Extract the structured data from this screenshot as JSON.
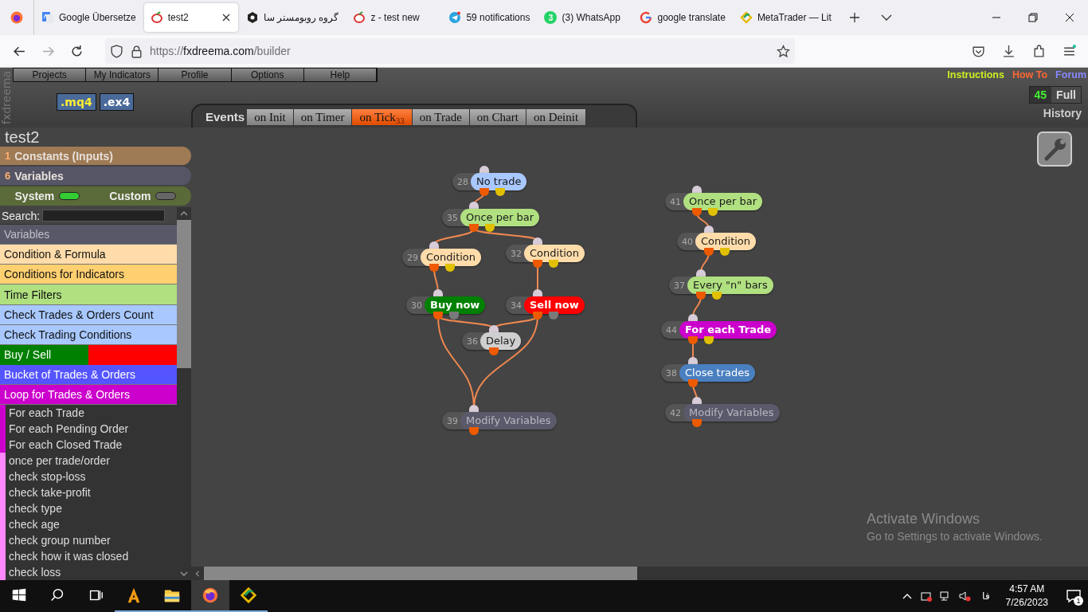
{
  "browser": {
    "tabs": [
      {
        "kind": "translate",
        "title": "Google Übersetze",
        "selected": false
      },
      {
        "kind": "fxdreema",
        "title": "test2",
        "selected": true
      },
      {
        "kind": "hexagon",
        "title": "گروه روبومستر سا",
        "selected": false
      },
      {
        "kind": "fxdreema",
        "title": "z - test new",
        "selected": false
      },
      {
        "kind": "telegram",
        "title": "59 notifications",
        "selected": false
      },
      {
        "kind": "whatsapp",
        "title": "(3) WhatsApp",
        "badge": "3",
        "selected": false
      },
      {
        "kind": "google",
        "title": "google translate",
        "selected": false
      },
      {
        "kind": "metatrader",
        "title": "MetaTrader — Lit",
        "selected": false
      }
    ],
    "url": {
      "scheme": "https://",
      "host": "fxdreema.com",
      "path": "/builder"
    }
  },
  "app": {
    "logo": "fxdreema",
    "menu": [
      "Projects",
      "My Indicators",
      "Profile",
      "Options",
      "Help"
    ],
    "exports": [
      ".mq4",
      ".ex4"
    ],
    "links": [
      {
        "label": "Instructions",
        "color": "#ccee22"
      },
      {
        "label": "How To",
        "color": "#ff6633"
      },
      {
        "label": "Forum",
        "color": "#8888ff"
      }
    ],
    "count": "45",
    "view_toggle": "Full",
    "history": "History"
  },
  "project": {
    "name": "test2",
    "constants": {
      "count": "1",
      "label": "Constants (Inputs)"
    },
    "variables": {
      "count": "6",
      "label": "Variables"
    },
    "toggles": [
      {
        "label": "System",
        "on": true
      },
      {
        "label": "Custom",
        "on": false
      }
    ],
    "search": {
      "label": "Search:"
    }
  },
  "categories": [
    {
      "label": "Variables",
      "color": "#585868"
    },
    {
      "label": "Condition & Formula",
      "color": "#ffdcaa"
    },
    {
      "label": "Conditions for Indicators",
      "color": "#ffd070"
    },
    {
      "label": "Time Filters",
      "color": "#b0e080"
    },
    {
      "label": "Check Trades & Orders Count",
      "color": "#a8c8ff"
    },
    {
      "label": "Check Trading Conditions",
      "color": "#a8c8ff"
    },
    {
      "label": "Buy / Sell",
      "color": "#008000",
      "parts": [
        {
          "color": "#ff0000"
        }
      ]
    },
    {
      "label": "Bucket of Trades & Orders",
      "color": "#5555ff"
    },
    {
      "label": "Loop for Trades & Orders",
      "color": "#cc00cc",
      "expanded": true,
      "children": [
        {
          "label": "For each Trade",
          "color": "#cc00cc"
        },
        {
          "label": "For each Pending Order",
          "color": "#cc00cc"
        },
        {
          "label": "For each Closed Trade",
          "color": "#cc00cc"
        },
        {
          "label": "once per trade/order",
          "color": "#ff88ff"
        },
        {
          "label": "check stop-loss",
          "color": "#ff88ff"
        },
        {
          "label": "check take-profit",
          "color": "#ff88ff"
        },
        {
          "label": "check type",
          "color": "#ff88ff"
        },
        {
          "label": "check age",
          "color": "#ff88ff"
        },
        {
          "label": "check group number",
          "color": "#ff88ff"
        },
        {
          "label": "check how it was closed",
          "color": "#ff88ff"
        },
        {
          "label": "check loss",
          "color": "#ff88ff"
        }
      ]
    }
  ],
  "events": {
    "label": "Events",
    "tabs": [
      {
        "label": "on Init",
        "selected": false
      },
      {
        "label": "on Timer",
        "selected": false
      },
      {
        "label": "on Tick",
        "badge": "33",
        "selected": true
      },
      {
        "label": "on Trade",
        "selected": false
      },
      {
        "label": "on Chart",
        "selected": false
      },
      {
        "label": "on Deinit",
        "selected": false
      }
    ]
  },
  "nodes": [
    {
      "number": "28",
      "label": "No trade",
      "kind": "check"
    },
    {
      "number": "35",
      "label": "Once per bar",
      "kind": "filter"
    },
    {
      "number": "29",
      "label": "Condition",
      "kind": "condition"
    },
    {
      "number": "32",
      "label": "Condition",
      "kind": "condition"
    },
    {
      "number": "30",
      "label": "Buy now",
      "kind": "buy"
    },
    {
      "number": "34",
      "label": "Sell now",
      "kind": "sell"
    },
    {
      "number": "36",
      "label": "Delay",
      "kind": "delay"
    },
    {
      "number": "39",
      "label": "Modify Variables",
      "kind": "modify"
    },
    {
      "number": "41",
      "label": "Once per bar",
      "kind": "filter"
    },
    {
      "number": "40",
      "label": "Condition",
      "kind": "condition"
    },
    {
      "number": "37",
      "label": "Every \"n\" bars",
      "kind": "filter"
    },
    {
      "number": "44",
      "label": "For each Trade",
      "kind": "loop"
    },
    {
      "number": "38",
      "label": "Close trades",
      "kind": "close"
    },
    {
      "number": "42",
      "label": "Modify Variables",
      "kind": "modify"
    }
  ],
  "activation": {
    "title": "Activate Windows",
    "message": "Go to Settings to activate Windows."
  },
  "taskbar": {
    "apps": [
      {
        "kind": "letter-a",
        "selected": false
      },
      {
        "kind": "folder",
        "selected": false
      },
      {
        "kind": "firefox",
        "selected": true
      },
      {
        "kind": "metatrader",
        "selected": false
      }
    ],
    "language": "فا",
    "time": "4:57 AM",
    "date": "7/26/2023",
    "notifications": "1"
  }
}
